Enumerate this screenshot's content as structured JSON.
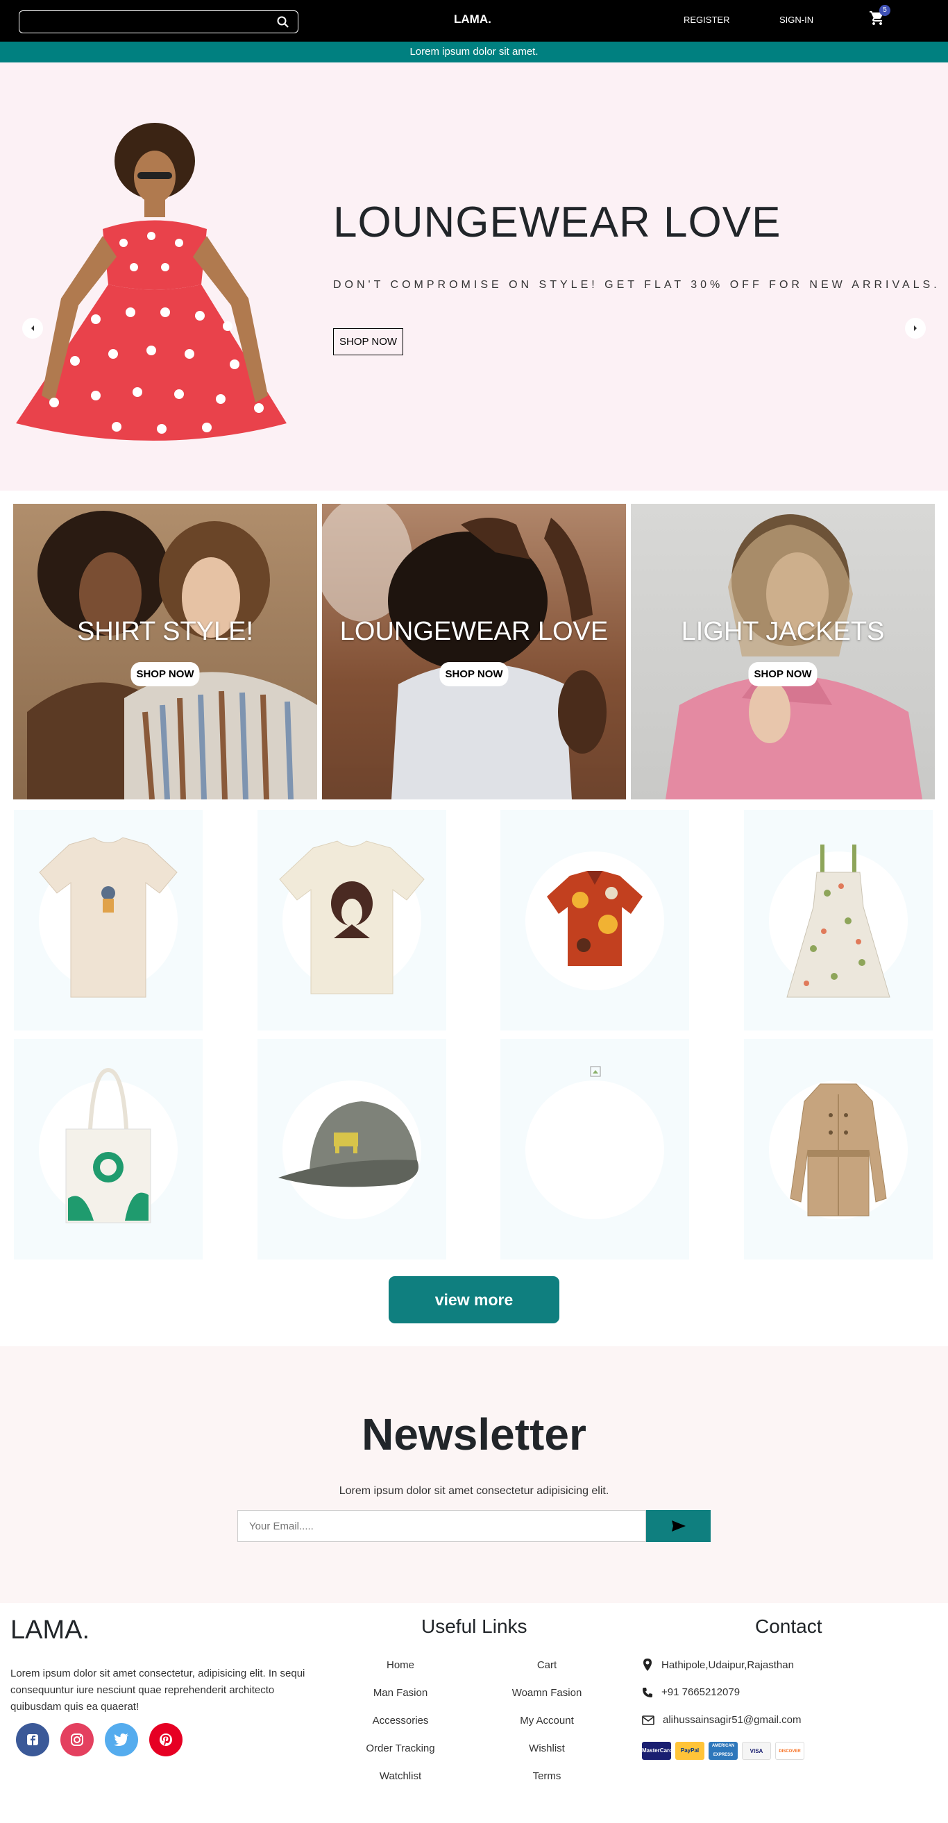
{
  "header": {
    "search_placeholder": "",
    "logo": "LAMA.",
    "register": "REGISTER",
    "signin": "SIGN-IN",
    "cart_count": "5"
  },
  "announcement": "Lorem ipsum dolor sit amet.",
  "hero": {
    "title": "LOUNGEWEAR LOVE",
    "description": "DON'T COMPROMISE ON STYLE! GET FLAT 30% OFF FOR NEW ARRIVALS.",
    "button": "SHOP NOW"
  },
  "categories": [
    {
      "title": "SHIRT STYLE!",
      "button": "SHOP NOW"
    },
    {
      "title": "LOUNGEWEAR LOVE",
      "button": "SHOP NOW"
    },
    {
      "title": "LIGHT JACKETS",
      "button": "SHOP NOW"
    }
  ],
  "products": [
    {
      "icon": "tshirt-beige-icon"
    },
    {
      "icon": "tshirt-print-icon"
    },
    {
      "icon": "shirt-pattern-icon"
    },
    {
      "icon": "dress-floral-icon"
    },
    {
      "icon": "tote-bag-icon"
    },
    {
      "icon": "cap-icon"
    },
    {
      "icon": "broken-image-icon"
    },
    {
      "icon": "trench-coat-icon"
    }
  ],
  "view_more": "view more",
  "newsletter": {
    "title": "Newsletter",
    "description": "Lorem ipsum dolor sit amet consectetur adipisicing elit.",
    "placeholder": "Your Email....."
  },
  "footer": {
    "logo": "LAMA.",
    "description": "Lorem ipsum dolor sit amet consectetur, adipisicing elit. In sequi consequuntur iure nesciunt quae reprehenderit architecto quibusdam quis ea quaerat!",
    "useful_links_title": "Useful Links",
    "links_left": [
      "Home",
      "Man Fasion",
      "Accessories",
      "Order Tracking",
      "Watchlist"
    ],
    "links_right": [
      "Cart",
      "Woamn Fasion",
      "My Account",
      "Wishlist",
      "Terms"
    ],
    "contact_title": "Contact",
    "address": "Hathipole,Udaipur,Rajasthan",
    "phone": "+91 7665212079",
    "email": "alihussainsagir51@gmail.com",
    "payments": [
      "MasterCard",
      "PayPal",
      "AMERICAN EXPRESS",
      "VISA",
      "DISCOVER"
    ]
  },
  "colors": {
    "accent": "#008080",
    "hero_bg": "#fcf1f5",
    "newsletter_bg": "#fcf5f5",
    "badge": "#3f51b5"
  }
}
